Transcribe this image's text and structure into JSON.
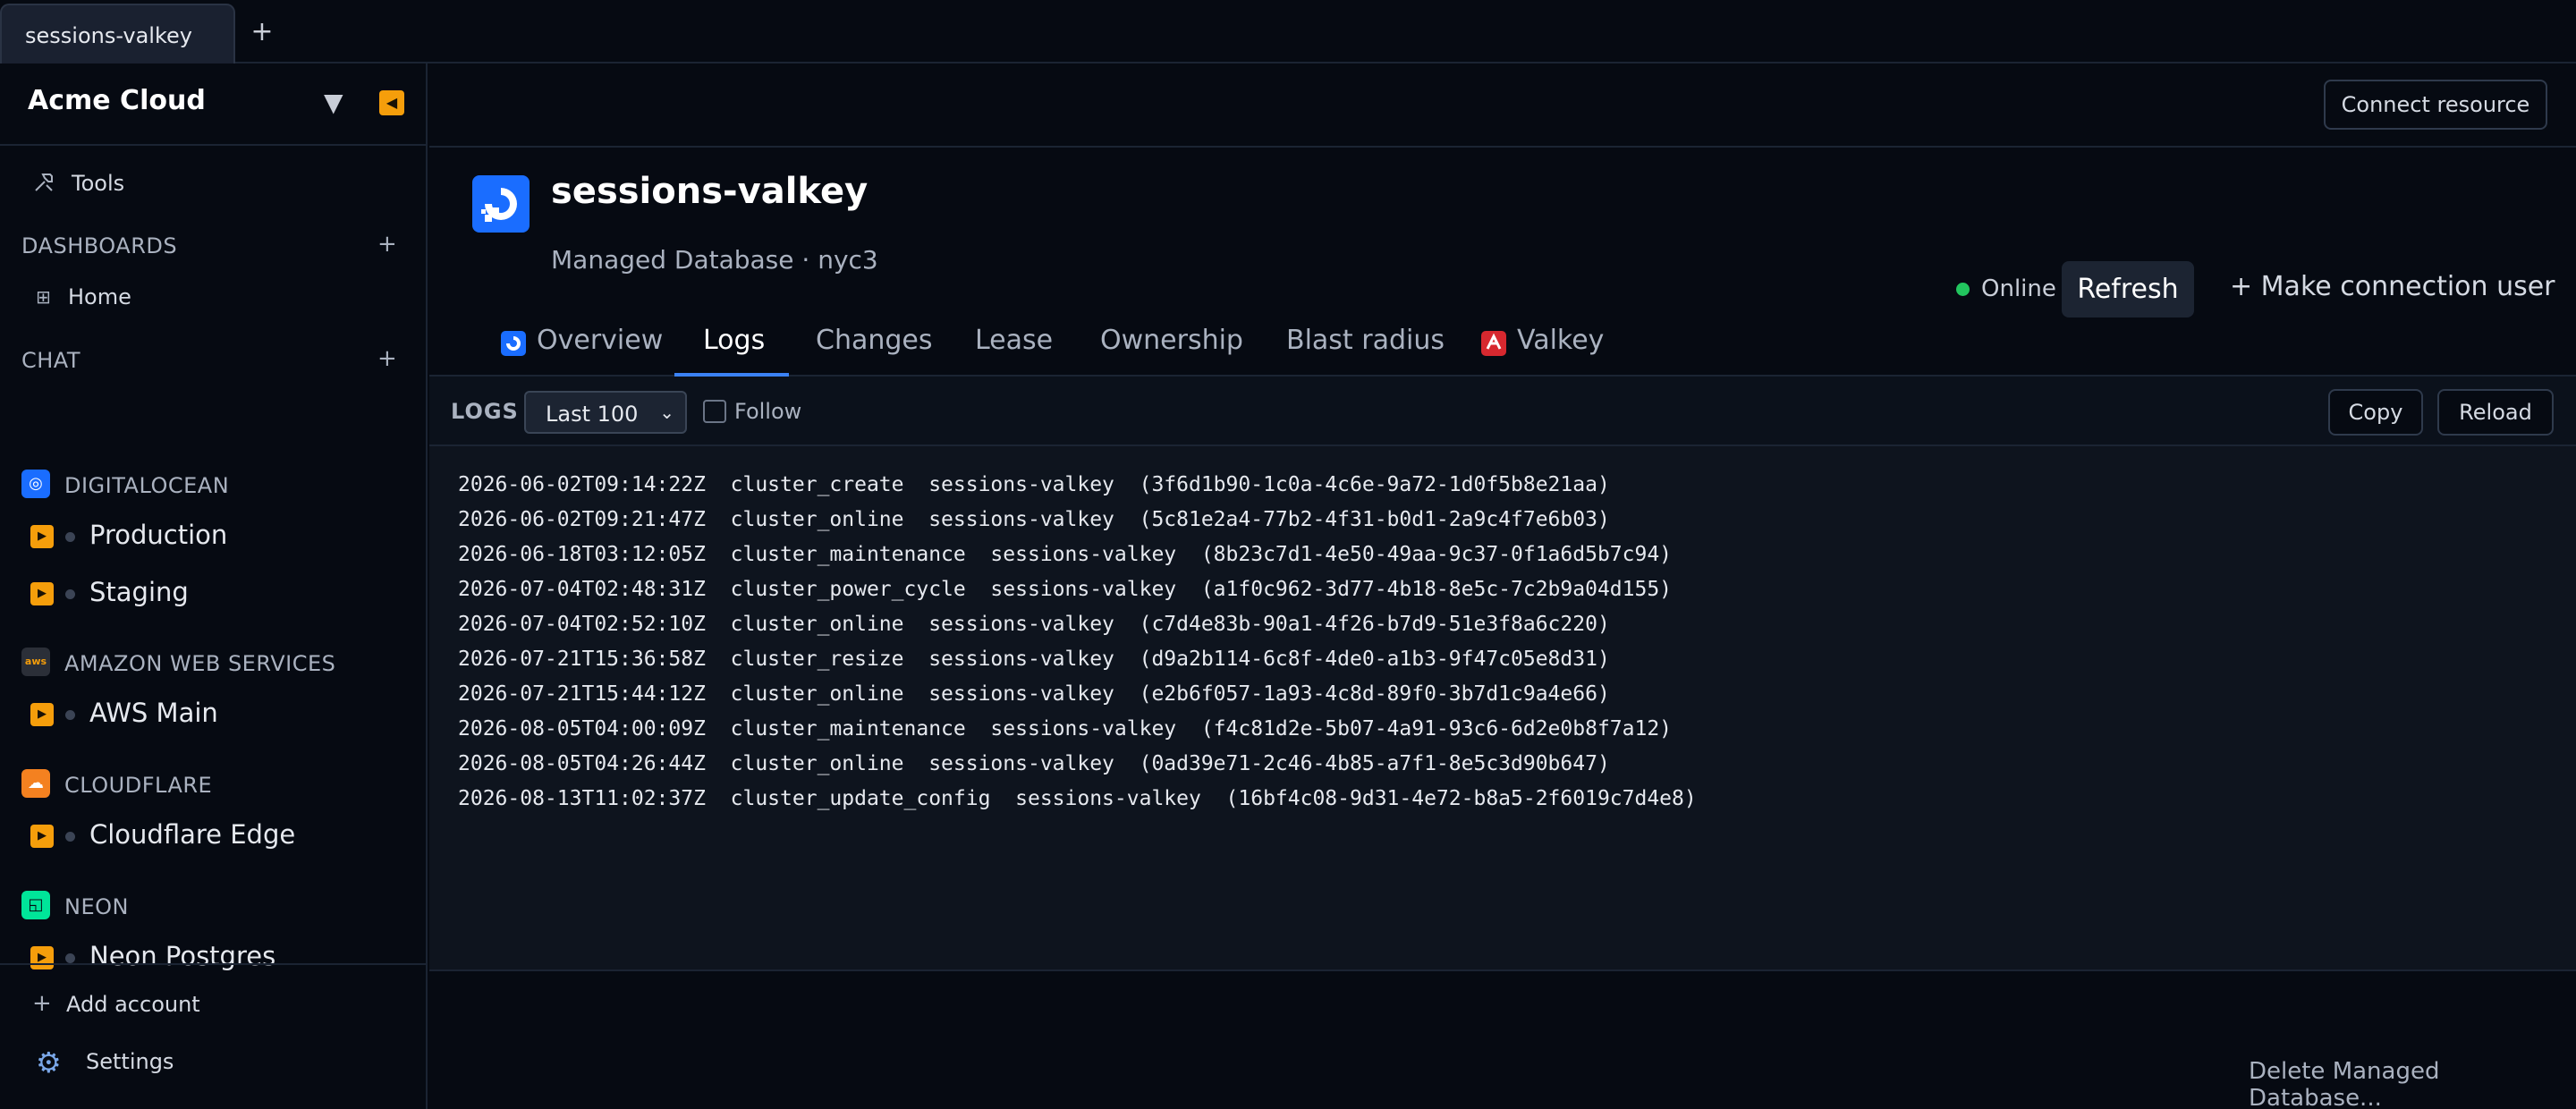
{
  "tabstrip": {
    "active_tab": "sessions-valkey",
    "new_tab_icon": "plus-icon",
    "new_tab_symbol": "+"
  },
  "sidebar": {
    "brand": "Acme Cloud",
    "brand_caret": "▼",
    "collapse_symbol": "◀",
    "tools_label": "Tools",
    "dashboards_header": "DASHBOARDS",
    "dashboards_add": "+",
    "home_label": "Home",
    "chat_header": "CHAT",
    "chat_add": "+",
    "providers": [
      {
        "name": "DIGITALOCEAN",
        "icon": "digitalocean-icon",
        "icon_color": "#1a6dff",
        "glyph": "◎",
        "resources": [
          "Production",
          "Staging"
        ]
      },
      {
        "name": "AMAZON WEB SERVICES",
        "icon": "aws-icon",
        "icon_color": "#2b2f38",
        "glyph": "aws",
        "resources": [
          "AWS Main"
        ]
      },
      {
        "name": "CLOUDFLARE",
        "icon": "cloudflare-icon",
        "icon_color": "#f48120",
        "glyph": "☁",
        "resources": [
          "Cloudflare Edge"
        ]
      },
      {
        "name": "NEON",
        "icon": "neon-icon",
        "icon_color": "#00e599",
        "glyph": "◱",
        "resources": [
          "Neon Postgres"
        ]
      }
    ],
    "play_symbol": "▶",
    "add_account_symbol": "+",
    "add_account": "Add account",
    "settings": "Settings"
  },
  "topbar": {
    "connect_resource": "Connect resource"
  },
  "resource": {
    "title": "sessions-valkey",
    "subtitle": "Managed Database · nyc3",
    "status": "Online",
    "status_color": "#22c55e",
    "refresh": "Refresh",
    "make_user": "+ Make connection user"
  },
  "tabs": {
    "overview": "Overview",
    "logs": "Logs",
    "changes": "Changes",
    "lease": "Lease",
    "ownership": "Ownership",
    "blast_radius": "Blast radius",
    "valkey": "Valkey",
    "active": "Logs"
  },
  "logs": {
    "label": "LOGS",
    "limit": "Last 100",
    "limit_caret": "⌄",
    "follow": "Follow",
    "follow_checked": false,
    "copy": "Copy",
    "reload": "Reload",
    "lines": [
      "2026-06-02T09:14:22Z  cluster_create  sessions-valkey  (3f6d1b90-1c0a-4c6e-9a72-1d0f5b8e21aa)",
      "2026-06-02T09:21:47Z  cluster_online  sessions-valkey  (5c81e2a4-77b2-4f31-b0d1-2a9c4f7e6b03)",
      "2026-06-18T03:12:05Z  cluster_maintenance  sessions-valkey  (8b23c7d1-4e50-49aa-9c37-0f1a6d5b7c94)",
      "2026-07-04T02:48:31Z  cluster_power_cycle  sessions-valkey  (a1f0c962-3d77-4b18-8e5c-7c2b9a04d155)",
      "2026-07-04T02:52:10Z  cluster_online  sessions-valkey  (c7d4e83b-90a1-4f26-b7d9-51e3f8a6c220)",
      "2026-07-21T15:36:58Z  cluster_resize  sessions-valkey  (d9a2b114-6c8f-4de0-a1b3-9f47c05e8d31)",
      "2026-07-21T15:44:12Z  cluster_online  sessions-valkey  (e2b6f057-1a93-4c8d-89f0-3b7d1c9a4e66)",
      "2026-08-05T04:00:09Z  cluster_maintenance  sessions-valkey  (f4c81d2e-5b07-4a91-93c6-6d2e0b8f7a12)",
      "2026-08-05T04:26:44Z  cluster_online  sessions-valkey  (0ad39e71-2c46-4b85-a7f1-8e5c3d90b647)",
      "2026-08-13T11:02:37Z  cluster_update_config  sessions-valkey  (16bf4c08-9d31-4e72-b8a5-2f6019c7d4e8)"
    ]
  },
  "footer": {
    "delete": "Delete Managed Database..."
  }
}
